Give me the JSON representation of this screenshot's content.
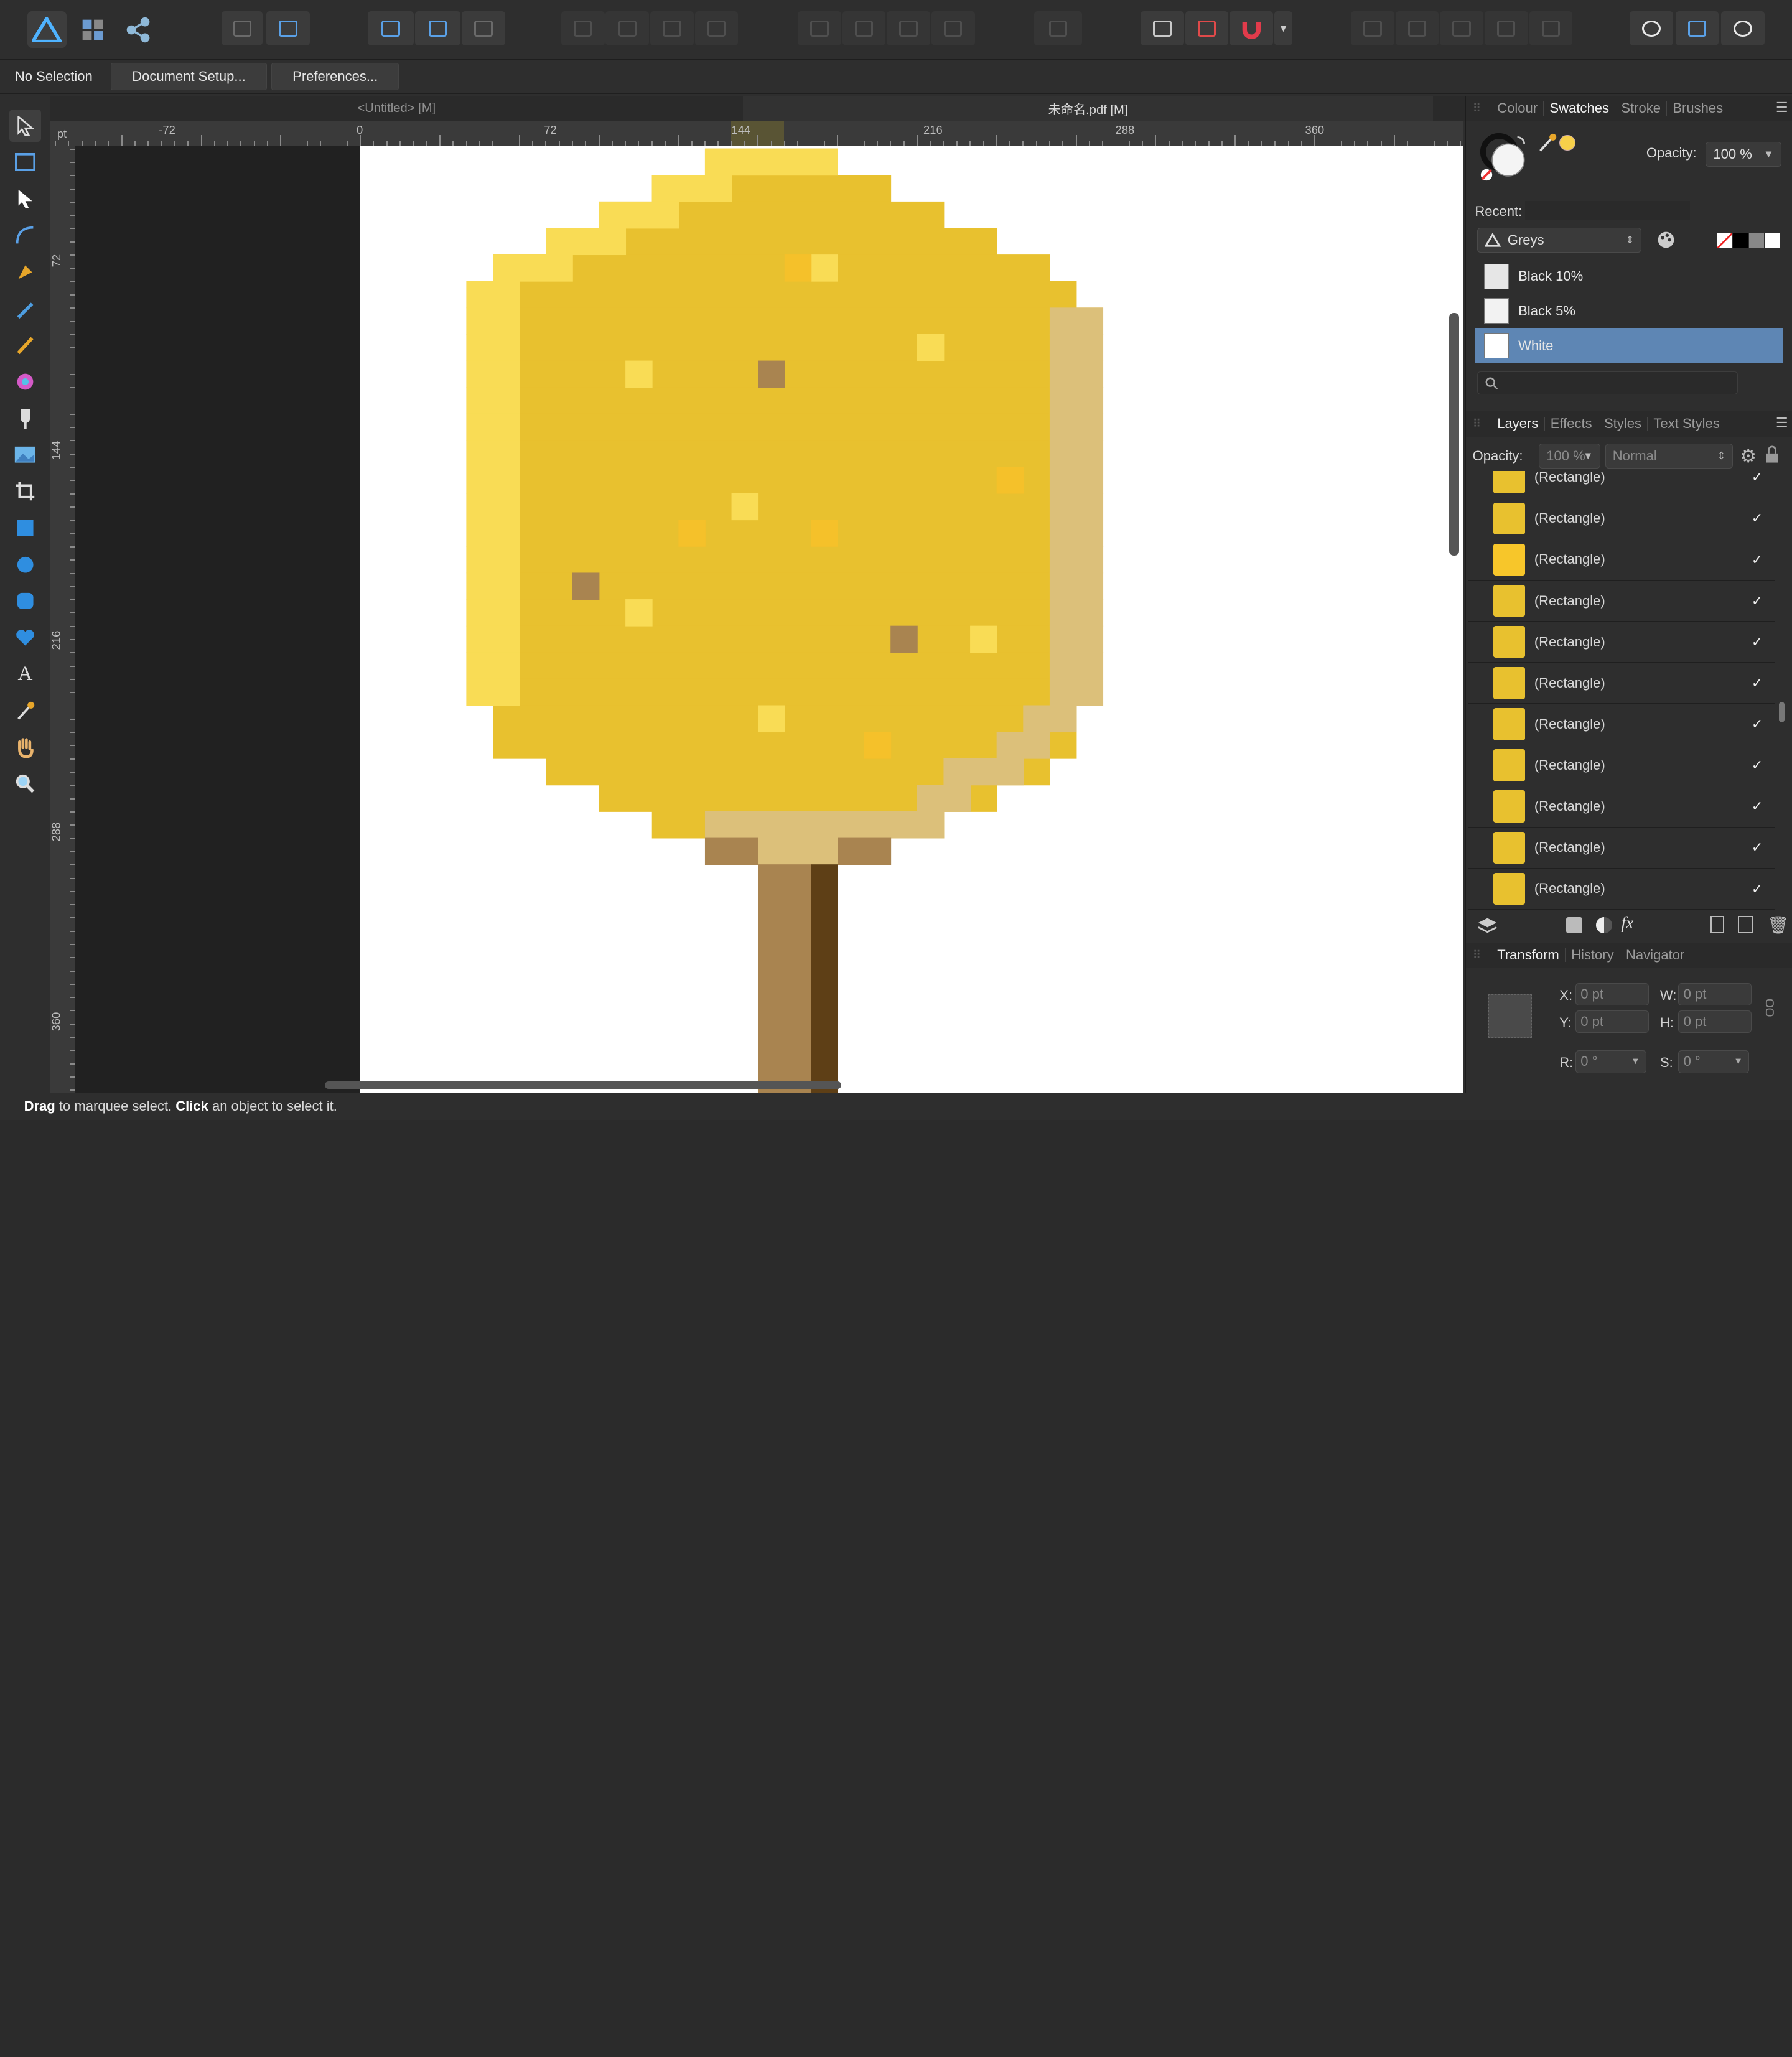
{
  "context_bar": {
    "selection": "No Selection",
    "document_setup": "Document Setup...",
    "preferences": "Preferences..."
  },
  "doc_tabs": [
    {
      "label": "<Untitled> [M]"
    },
    {
      "label": "未命名.pdf [M]"
    }
  ],
  "rulers": {
    "unit": "pt",
    "top_labels": [
      "-72",
      "0",
      "72",
      "144",
      "216",
      "288",
      "360"
    ],
    "left_labels": [
      "72",
      "144",
      "216",
      "288",
      "360"
    ]
  },
  "swatch_panel": {
    "tabs": [
      "Colour",
      "Swatches",
      "Stroke",
      "Brushes"
    ],
    "active_tab": "Swatches",
    "opacity_label": "Opacity:",
    "opacity_value": "100 %",
    "recent_label": "Recent:",
    "palette": "Greys",
    "swatches": [
      {
        "name": "Black 10%",
        "color": "#e6e6e6"
      },
      {
        "name": "Black 5%",
        "color": "#f2f2f2"
      },
      {
        "name": "White",
        "color": "#ffffff",
        "selected": true
      }
    ],
    "search_placeholder": ""
  },
  "layers_panel": {
    "tabs": [
      "Layers",
      "Effects",
      "Styles",
      "Text Styles"
    ],
    "active_tab": "Layers",
    "opacity_label": "Opacity:",
    "opacity_value": "100 %",
    "blend_mode": "Normal",
    "layers": [
      {
        "name": "(Rectangle)",
        "color": "#e8c12f"
      },
      {
        "name": "(Rectangle)",
        "color": "#e8c12f"
      },
      {
        "name": "(Rectangle)",
        "color": "#f7c62a"
      },
      {
        "name": "(Rectangle)",
        "color": "#e8c12f"
      },
      {
        "name": "(Rectangle)",
        "color": "#e8c12f"
      },
      {
        "name": "(Rectangle)",
        "color": "#e8c12f"
      },
      {
        "name": "(Rectangle)",
        "color": "#e8c12f"
      },
      {
        "name": "(Rectangle)",
        "color": "#e8c12f"
      },
      {
        "name": "(Rectangle)",
        "color": "#e8c12f"
      },
      {
        "name": "(Rectangle)",
        "color": "#e8c12f"
      },
      {
        "name": "(Rectangle)",
        "color": "#e8c12f"
      }
    ]
  },
  "transform_panel": {
    "tabs": [
      "Transform",
      "History",
      "Navigator"
    ],
    "active_tab": "Transform",
    "x_label": "X:",
    "x": "0 pt",
    "y_label": "Y:",
    "y": "0 pt",
    "w_label": "W:",
    "w": "0 pt",
    "h_label": "H:",
    "h": "0 pt",
    "r_label": "R:",
    "r": "0 °",
    "s_label": "S:",
    "s": "0 °"
  },
  "status": {
    "drag": "Drag",
    "drag_text": " to marquee select. ",
    "click": "Click",
    "click_text": " an object to select it."
  },
  "colors": {
    "gold": "#e8c12f",
    "light_gold": "#f9dc55",
    "tan": "#dcc07a",
    "brown": "#a98450",
    "dark_brown": "#5e3f16",
    "accent": "#5e86b4"
  }
}
